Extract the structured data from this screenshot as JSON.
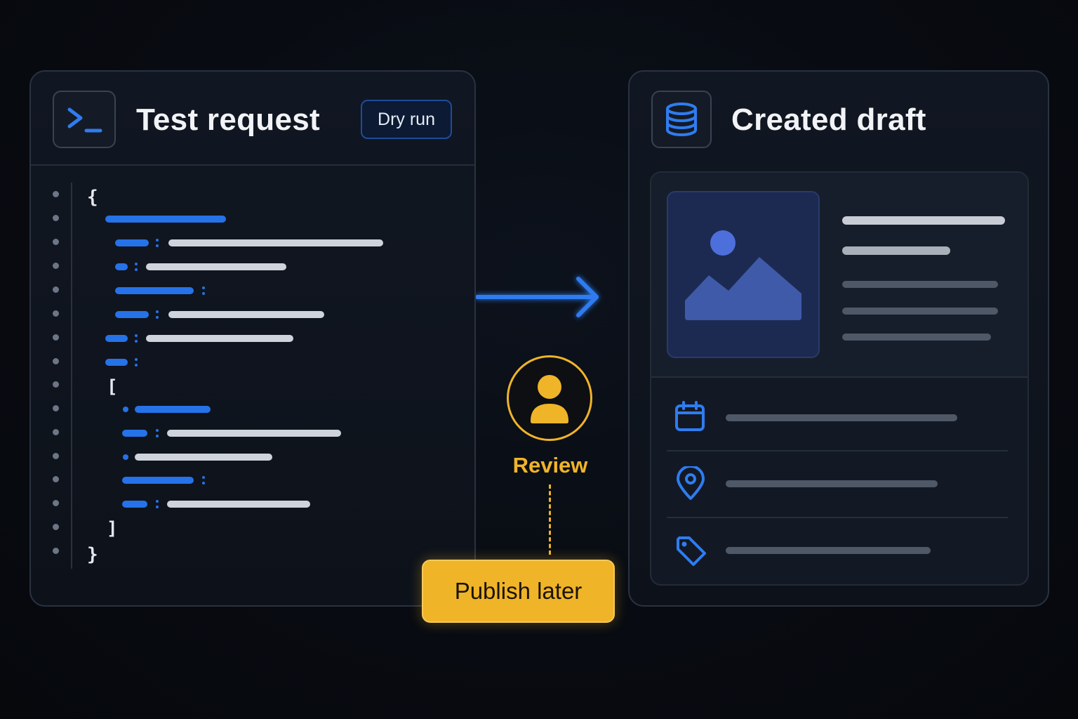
{
  "left_panel": {
    "title": "Test request",
    "badge": "Dry run",
    "icon": "terminal-icon"
  },
  "right_panel": {
    "title": "Created draft",
    "icon": "database-icon",
    "rows": [
      {
        "icon": "calendar-icon"
      },
      {
        "icon": "location-pin-icon"
      },
      {
        "icon": "tag-icon"
      }
    ]
  },
  "review": {
    "label": "Review",
    "icon": "user-icon"
  },
  "action": {
    "label": "Publish later"
  },
  "code": {
    "open_brace": "{",
    "close_brace": "}",
    "open_bracket": "[",
    "close_bracket": "]"
  },
  "colors": {
    "accent_blue": "#2672e8",
    "accent_yellow": "#f0b429",
    "background": "#080b11"
  }
}
